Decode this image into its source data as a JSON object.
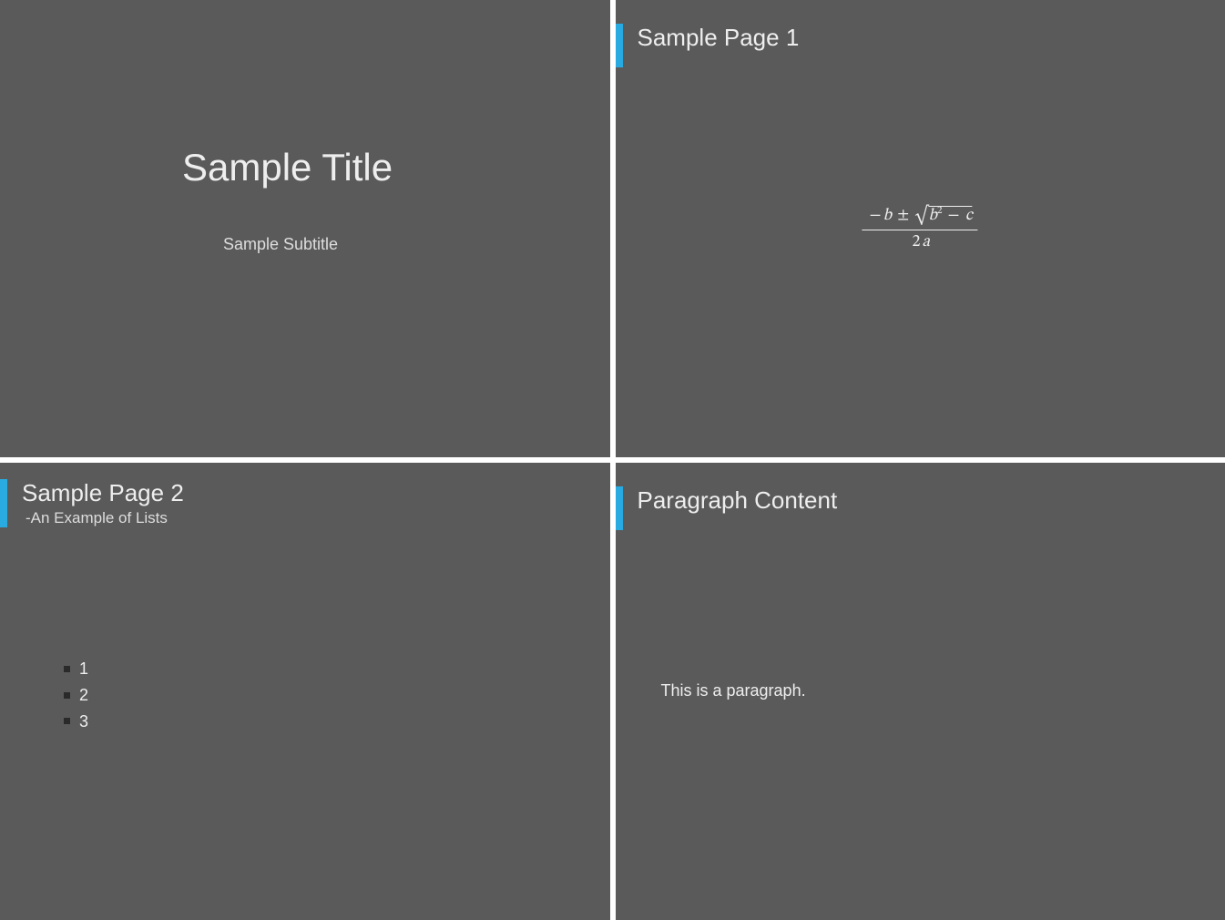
{
  "slides": {
    "title_slide": {
      "title": "Sample Title",
      "subtitle": "Sample Subtitle"
    },
    "page1": {
      "frame_title": "Sample Page 1",
      "formula": {
        "neg": "−",
        "b": "b",
        "pm": "±",
        "b2": "b",
        "sq": "2",
        "minus": "−",
        "c": "c",
        "two": "2",
        "a": "a"
      }
    },
    "page2": {
      "frame_title": "Sample Page 2",
      "frame_subtitle": "-An Example of Lists",
      "items": [
        "1",
        "2",
        "3"
      ]
    },
    "page3": {
      "frame_title": "Paragraph Content",
      "paragraph": "This is a paragraph."
    }
  }
}
